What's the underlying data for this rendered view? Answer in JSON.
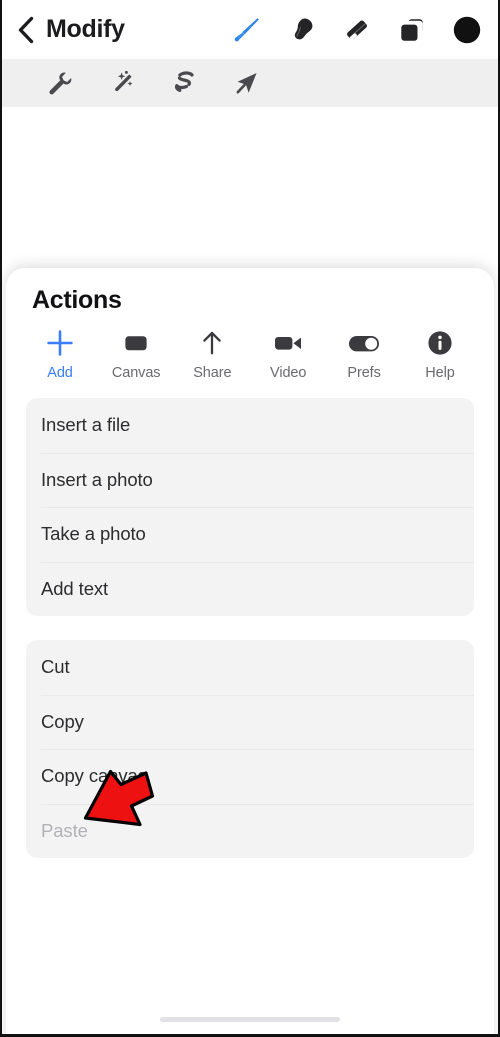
{
  "navbar": {
    "back_label": "back-chevron",
    "title": "Modify",
    "tools": [
      {
        "name": "brush-icon",
        "label": "Brush",
        "active": true
      },
      {
        "name": "smudge-icon",
        "label": "Smudge",
        "active": false
      },
      {
        "name": "eraser-icon",
        "label": "Eraser",
        "active": false
      },
      {
        "name": "layers-icon",
        "label": "Layers",
        "active": false
      },
      {
        "name": "color-swatch-icon",
        "label": "Color",
        "active": false,
        "color": "#111111"
      }
    ]
  },
  "subbar": {
    "tools": [
      {
        "name": "wrench-icon",
        "label": "Adjustments"
      },
      {
        "name": "magic-wand-icon",
        "label": "Effects"
      },
      {
        "name": "lasso-icon",
        "label": "Selection"
      },
      {
        "name": "cursor-arrow-icon",
        "label": "Transform"
      }
    ]
  },
  "sheet": {
    "title": "Actions",
    "tabs": [
      {
        "label": "Add",
        "icon": "plus-icon",
        "active": true
      },
      {
        "label": "Canvas",
        "icon": "canvas-icon",
        "active": false
      },
      {
        "label": "Share",
        "icon": "share-arrow-up-icon",
        "active": false
      },
      {
        "label": "Video",
        "icon": "video-camera-icon",
        "active": false
      },
      {
        "label": "Prefs",
        "icon": "toggle-switch-icon",
        "active": false
      },
      {
        "label": "Help",
        "icon": "info-circle-icon",
        "active": false
      }
    ],
    "groups": [
      {
        "name": "insert-group",
        "rows": [
          {
            "label": "Insert a file",
            "disabled": false
          },
          {
            "label": "Insert a photo",
            "disabled": false
          },
          {
            "label": "Take a photo",
            "disabled": false
          },
          {
            "label": "Add text",
            "disabled": false
          }
        ]
      },
      {
        "name": "clipboard-group",
        "rows": [
          {
            "label": "Cut",
            "disabled": false
          },
          {
            "label": "Copy",
            "disabled": false
          },
          {
            "label": "Copy canvas",
            "disabled": false
          },
          {
            "label": "Paste",
            "disabled": true
          }
        ]
      }
    ]
  },
  "annotation": {
    "arrow": "red-pointer-arrow",
    "points_at": "Paste",
    "color": "#ee1111",
    "outline": "#000000"
  },
  "colors": {
    "accent": "#3a7dfc",
    "sheet_bg": "#ffffff",
    "group_bg": "#f3f3f4",
    "subbar_bg": "#efefef",
    "text_primary": "#2d2d2f",
    "text_secondary": "#6a6a6e",
    "text_disabled": "#b2b2b6"
  }
}
